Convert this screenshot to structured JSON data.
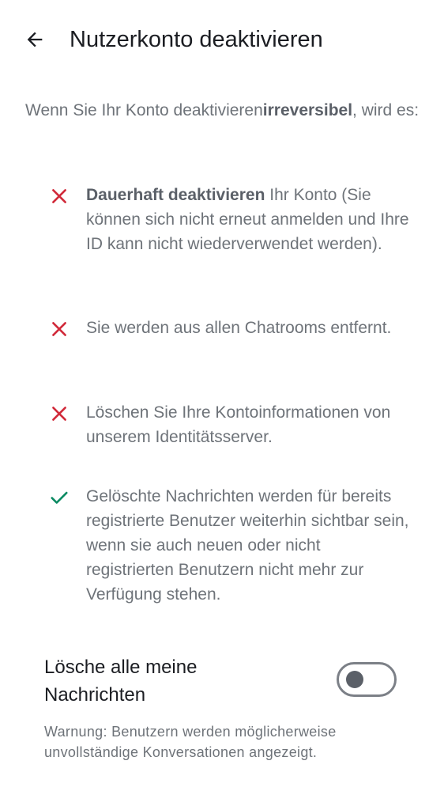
{
  "header": {
    "title": "Nutzerkonto deaktivieren"
  },
  "intro": {
    "before": "Wenn Sie Ihr Konto deaktivieren",
    "bold": "irreversibel",
    "after": ", wird es:"
  },
  "consequences": [
    {
      "icon": "close-icon",
      "color": "#d12a3a",
      "bold": "Dauerhaft deaktivieren",
      "text": " Ihr Konto (Sie können sich nicht erneut anmelden und Ihre ID kann nicht wiederverwendet werden)."
    },
    {
      "icon": "close-icon",
      "color": "#d12a3a",
      "bold": "",
      "text": "Sie werden aus allen Chatrooms entfernt."
    },
    {
      "icon": "close-icon",
      "color": "#d12a3a",
      "bold": "",
      "text": "Löschen Sie Ihre Kontoinformationen von unserem Identitätsserver."
    },
    {
      "icon": "check-icon",
      "color": "#0a8a62",
      "bold": "",
      "text": "Gelöschte Nachrichten werden für bereits registrierte Benutzer weiterhin sichtbar sein, wenn sie auch neuen oder nicht registrierten Benutzern nicht mehr zur Verfügung stehen."
    }
  ],
  "delete_messages": {
    "label": "Lösche alle meine Nachrichten",
    "enabled": false
  },
  "warning": "Warnung: Benutzern werden möglicherweise unvollständige Konversationen angezeigt."
}
